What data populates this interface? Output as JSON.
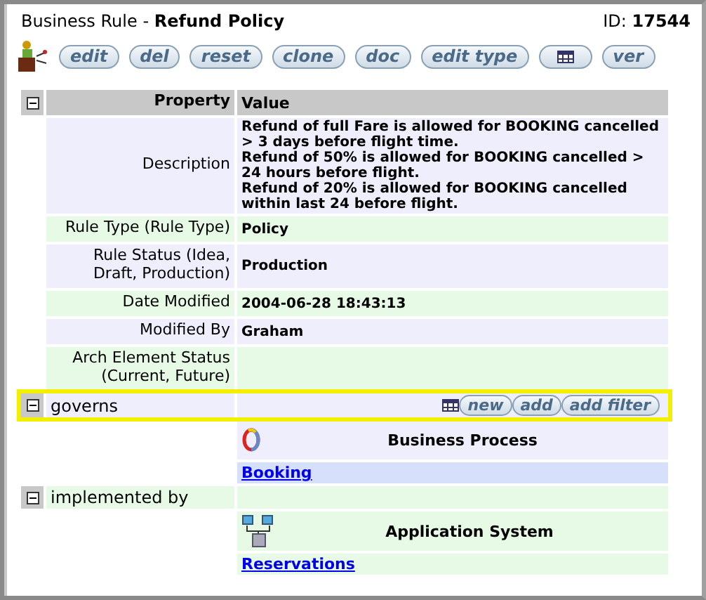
{
  "header": {
    "type_label": "Business Rule",
    "separator": "-",
    "name": "Refund Policy",
    "id_label": "ID:",
    "id": "17544"
  },
  "toolbar": [
    {
      "kind": "text",
      "label": "edit"
    },
    {
      "kind": "text",
      "label": "del"
    },
    {
      "kind": "text",
      "label": "reset"
    },
    {
      "kind": "text",
      "label": "clone"
    },
    {
      "kind": "text",
      "label": "doc"
    },
    {
      "kind": "text",
      "label": "edit type"
    },
    {
      "kind": "grid"
    },
    {
      "kind": "text",
      "label": "ver"
    }
  ],
  "properties": {
    "expanded": true,
    "columns": [
      "Property",
      "Value"
    ],
    "rows": [
      {
        "property": "Description",
        "value": [
          "Refund of full Fare is allowed for BOOKING cancelled > 3 days before flight time.",
          "Refund of 50% is allowed for BOOKING cancelled > 24 hours before flight.",
          "Refund of 20% is allowed for BOOKING cancelled within last 24 before flight."
        ]
      },
      {
        "property": "Rule Type (Rule Type)",
        "value": [
          "Policy"
        ]
      },
      {
        "property": "Rule Status (Idea, Draft, Production)",
        "value": [
          "Production"
        ]
      },
      {
        "property": "Date Modified",
        "value": [
          "2004-06-28 18:43:13"
        ]
      },
      {
        "property": "Modified By",
        "value": [
          "Graham"
        ]
      },
      {
        "property": "Arch Element Status (Current, Future)",
        "value": []
      }
    ]
  },
  "relations": [
    {
      "label": "governs",
      "expanded": true,
      "highlighted": true,
      "actions": [
        "new",
        "add",
        "add filter"
      ],
      "items": [
        {
          "kind": "process",
          "type": "Business Process",
          "link": "Booking"
        }
      ]
    },
    {
      "label": "implemented by",
      "expanded": true,
      "highlighted": false,
      "items": [
        {
          "kind": "system",
          "type": "Application System",
          "link": "Reservations"
        }
      ]
    }
  ]
}
